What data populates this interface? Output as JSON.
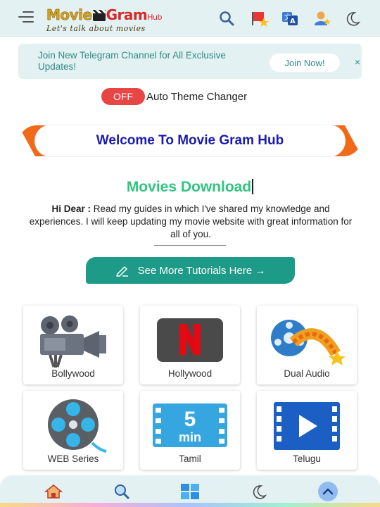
{
  "header": {
    "logo": {
      "word1": "Movie",
      "word2": "Gram",
      "word3": "Hub",
      "tagline": "Let's talk about movies"
    },
    "icons": [
      "menu-icon",
      "search-icon",
      "flag-star-icon",
      "translate-icon",
      "user-icon",
      "moon-icon"
    ]
  },
  "banner": {
    "text": "Join New Telegram Channel for All Exclusive Updates!",
    "button": "Join Now!",
    "close": "×"
  },
  "theme": {
    "toggle": "OFF",
    "label": "Auto Theme Changer"
  },
  "welcome": "Welcome To Movie Gram Hub",
  "section": {
    "title": "Movies Download",
    "intro_bold": "Hi Dear :",
    "intro_text": " Read my guides in which I've shared my knowledge and experiences. I will keep updating my movie website with great information for all of you.",
    "button": "See More Tutorials Here →"
  },
  "categories": [
    {
      "label": "Bollywood",
      "icon": "movie-camera-icon"
    },
    {
      "label": "Hollywood",
      "icon": "netflix-icon"
    },
    {
      "label": "Dual Audio",
      "icon": "film-reel-icon"
    },
    {
      "label": "WEB Series",
      "icon": "film-reel-disc-icon"
    },
    {
      "label": "Tamil",
      "icon": "five-min-film-icon"
    },
    {
      "label": "Telugu",
      "icon": "video-play-icon"
    }
  ],
  "timer_icon": {
    "number": "5",
    "unit": "min"
  },
  "bottom_nav": [
    "home-icon",
    "search-icon",
    "grid-icon",
    "moon-icon",
    "scroll-top-icon"
  ],
  "colors": {
    "header_bg": "#e3f1f2",
    "accent_teal": "#1e9a88",
    "welcome_blue": "#1a1ab0",
    "title_green": "#2ec67f",
    "toggle_red": "#e84545",
    "ribbon_orange": "#f16a1a"
  }
}
